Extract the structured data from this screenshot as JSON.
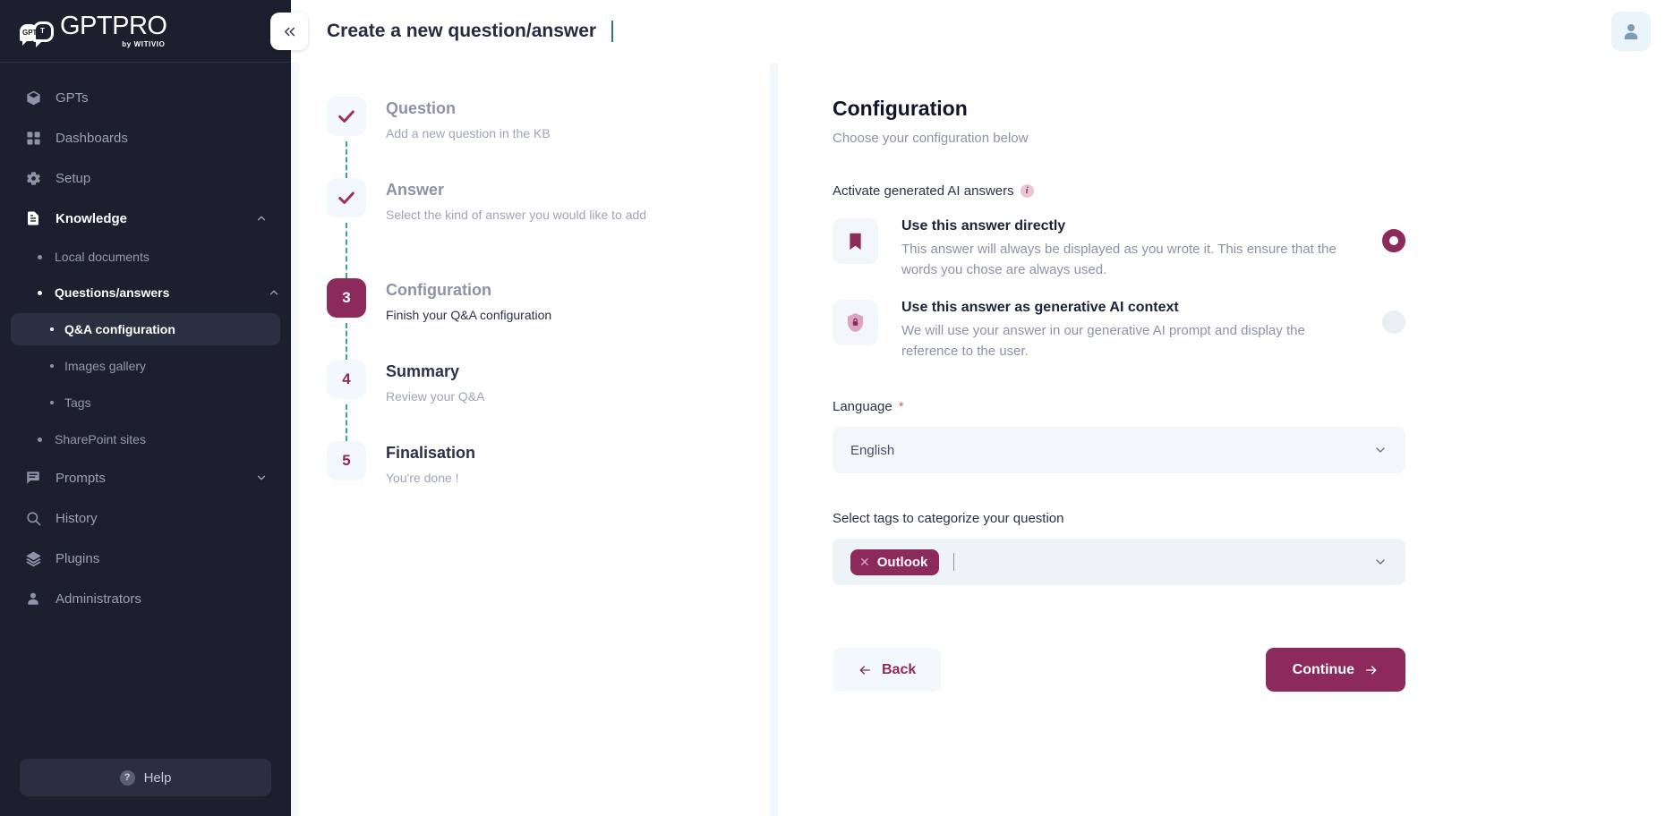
{
  "brand": {
    "name": "GPTPRO",
    "tagline": "by WITIVIO",
    "bubble_left_text": "GPT",
    "bubble_right_text": "T",
    "accent_color": "#8d2a5c",
    "sidebar_bg": "#1c1f2e"
  },
  "sidebar": {
    "items": [
      {
        "label": "GPTs",
        "icon": "cube-icon"
      },
      {
        "label": "Dashboards",
        "icon": "grid-icon"
      },
      {
        "label": "Setup",
        "icon": "gear-icon"
      },
      {
        "label": "Knowledge",
        "icon": "document-lines-icon",
        "expanded": true
      },
      {
        "label": "Prompts",
        "icon": "chat-lines-icon"
      },
      {
        "label": "History",
        "icon": "search-clock-icon"
      },
      {
        "label": "Plugins",
        "icon": "layers-icon"
      },
      {
        "label": "Administrators",
        "icon": "person-icon"
      }
    ],
    "knowledge_children": [
      {
        "label": "Local documents"
      },
      {
        "label": "Questions/answers",
        "expanded": true
      },
      {
        "label": "SharePoint sites"
      }
    ],
    "questions_children": [
      {
        "label": "Q&A configuration",
        "selected": true
      },
      {
        "label": "Images gallery",
        "selected": false
      },
      {
        "label": "Tags",
        "selected": false
      }
    ],
    "help_label": "Help",
    "help_icon": "question-mark-icon"
  },
  "topbar": {
    "collapse_icon": "chevron-double-left-icon",
    "title": "Create a new question/answer",
    "avatar_icon": "user-avatar-icon"
  },
  "stepper": {
    "steps": [
      {
        "number": "1",
        "state": "done",
        "title": "Question",
        "description": "Add a new question in the KB",
        "badge_glyph": "check-icon"
      },
      {
        "number": "2",
        "state": "done",
        "title": "Answer",
        "description": "Select the kind of answer you would like to add",
        "badge_glyph": "check-icon"
      },
      {
        "number": "3",
        "state": "active",
        "title": "Configuration",
        "description": "Finish your Q&A configuration",
        "badge_glyph": "3"
      },
      {
        "number": "4",
        "state": "todo",
        "title": "Summary",
        "description": "Review your Q&A",
        "badge_glyph": "4"
      },
      {
        "number": "5",
        "state": "todo",
        "title": "Finalisation",
        "description": "You're done !",
        "badge_glyph": "5"
      }
    ]
  },
  "panel": {
    "heading": "Configuration",
    "subheading": "Choose your configuration below",
    "ai_answers_label": "Activate generated AI answers",
    "ai_answers_info_icon": "info-icon",
    "options": [
      {
        "icon": "bookmark-icon",
        "title": "Use this answer directly",
        "description": "This answer will always be displayed as you wrote it. This ensure that the words you chose are always used.",
        "selected": true
      },
      {
        "icon": "shield-lock-icon",
        "title": "Use this answer as generative AI context",
        "description": "We will use your answer in our generative AI prompt and display the reference to the user.",
        "selected": false
      }
    ],
    "language_label": "Language",
    "language_required_mark": "*",
    "language_value": "English",
    "language_chevron_icon": "chevron-down-icon",
    "tags_label": "Select tags to categorize your question",
    "tags": [
      {
        "label": "Outlook",
        "remove_icon": "close-x-icon"
      }
    ],
    "tags_chevron_icon": "chevron-down-icon",
    "back_label": "Back",
    "back_icon": "arrow-left-icon",
    "continue_label": "Continue",
    "continue_icon": "arrow-right-icon"
  }
}
